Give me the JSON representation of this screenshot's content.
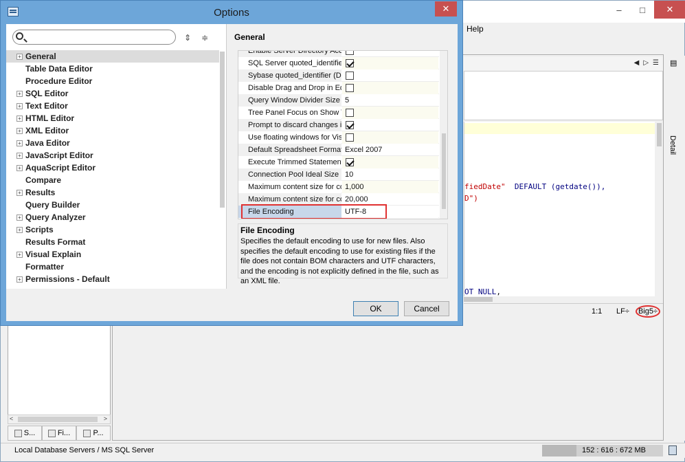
{
  "dialog": {
    "title": "Options",
    "close_glyph": "✕",
    "search": {
      "placeholder": "",
      "value": ""
    },
    "tree_items": [
      {
        "label": "General",
        "expandable": true,
        "selected": true
      },
      {
        "label": "Table Data Editor",
        "expandable": false
      },
      {
        "label": "Procedure Editor",
        "expandable": false
      },
      {
        "label": "SQL Editor",
        "expandable": true
      },
      {
        "label": "Text Editor",
        "expandable": true
      },
      {
        "label": "HTML Editor",
        "expandable": true
      },
      {
        "label": "XML Editor",
        "expandable": true
      },
      {
        "label": "Java Editor",
        "expandable": true
      },
      {
        "label": "JavaScript Editor",
        "expandable": true
      },
      {
        "label": "AquaScript Editor",
        "expandable": true
      },
      {
        "label": "Compare",
        "expandable": false
      },
      {
        "label": "Results",
        "expandable": true
      },
      {
        "label": "Query Builder",
        "expandable": false
      },
      {
        "label": "Query Analyzer",
        "expandable": true
      },
      {
        "label": "Scripts",
        "expandable": true
      },
      {
        "label": "Results Format",
        "expandable": false
      },
      {
        "label": "Visual Explain",
        "expandable": true
      },
      {
        "label": "Formatter",
        "expandable": false
      },
      {
        "label": "Permissions - Default",
        "expandable": true
      }
    ],
    "section_title": "General",
    "properties": [
      {
        "name": "Enable Server Directory Access",
        "type": "checkbox",
        "checked": false
      },
      {
        "name": "SQL Server quoted_identifier",
        "type": "checkbox",
        "checked": true
      },
      {
        "name": "Sybase quoted_identifier (D...",
        "type": "checkbox",
        "checked": false
      },
      {
        "name": "Disable Drag and Drop in Editor",
        "type": "checkbox",
        "checked": false
      },
      {
        "name": "Query Window Divider Size",
        "type": "text",
        "value": "5"
      },
      {
        "name": "Tree Panel Focus on Show T...",
        "type": "checkbox",
        "checked": false
      },
      {
        "name": "Prompt to discard changes in...",
        "type": "checkbox",
        "checked": true
      },
      {
        "name": "Use floating windows for Vis...",
        "type": "checkbox",
        "checked": false
      },
      {
        "name": "Default Spreadsheet Format",
        "type": "text",
        "value": "Excel 2007"
      },
      {
        "name": "Execute Trimmed Statement ...",
        "type": "checkbox",
        "checked": true
      },
      {
        "name": "Connection Pool Ideal Size",
        "type": "text",
        "value": "10"
      },
      {
        "name": "Maximum content size for co...",
        "type": "text",
        "value": "1,000"
      },
      {
        "name": "Maximum content size for co...",
        "type": "text",
        "value": "20,000"
      },
      {
        "name": "File Encoding",
        "type": "text",
        "value": "UTF-8",
        "selected": true
      }
    ],
    "description": {
      "title": "File Encoding",
      "text": "Specifies the default encoding to use for new files. Also specifies the default encoding to use for existing files if the file does not contain BOM characters and UTF characters, and the encoding is not explicitly defined in the file, such as an XML file."
    },
    "ok_label": "OK",
    "cancel_label": "Cancel"
  },
  "app": {
    "menu_help": "Help",
    "detail_label": "Detail",
    "window_buttons": {
      "minimize": "–",
      "maximize": "□",
      "close": "✕"
    },
    "code_lines": [
      {
        "pre": "",
        "str": "fiedDate\"",
        "post": "  ",
        "kw": "DEFAULT",
        "tail": " (getdate()),"
      },
      {
        "pre": "",
        "str": "D\")",
        "post": "",
        "kw": "",
        "tail": ""
      },
      {
        "pre": "",
        "str": "",
        "post": "",
        "kw": "OT NULL",
        "tail": ","
      }
    ],
    "editor_status": {
      "position": "1:1",
      "line_ending": "LF",
      "encoding": "Big5"
    },
    "left_tabs": [
      "S...",
      "Fi...",
      "P..."
    ],
    "status_text": "Local Database Servers / MS SQL Server",
    "memory": "152 : 616 : 672 MB"
  }
}
